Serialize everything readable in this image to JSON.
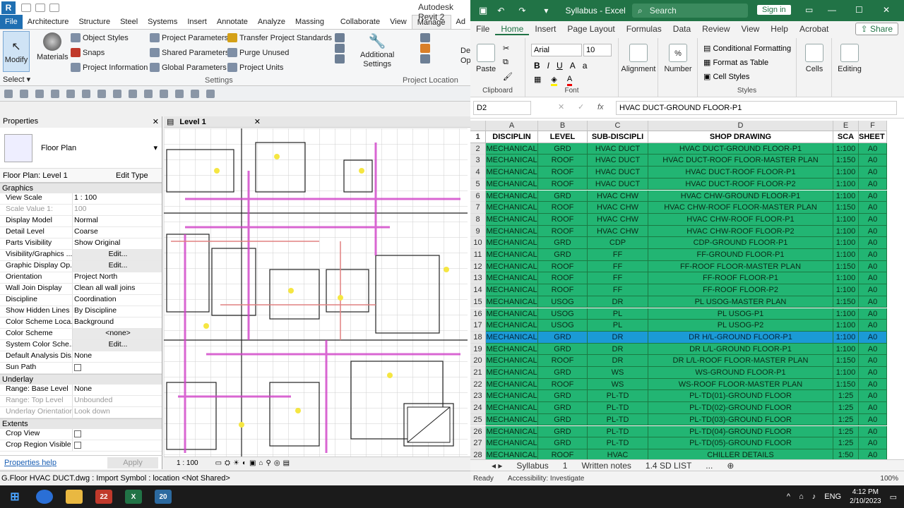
{
  "revit": {
    "title": "Autodesk Revit 2",
    "tabs": [
      "File",
      "Architecture",
      "Structure",
      "Steel",
      "Systems",
      "Insert",
      "Annotate",
      "Analyze",
      "Massing & Site",
      "Collaborate",
      "View",
      "Manage",
      "Ad"
    ],
    "ribbon": {
      "modify": "Modify",
      "select": "Select",
      "materials": "Materials",
      "object_styles": "Object  Styles",
      "snaps": "Snaps",
      "project_information": "Project  Information",
      "project_parameters": "Project  Parameters",
      "shared_parameters": "Shared  Parameters",
      "global_parameters": "Global  Parameters",
      "transfer": "Transfer  Project Standards",
      "purge": "Purge  Unused",
      "units": "Project  Units",
      "settings_label": "Settings",
      "additional": "Additional",
      "additional2": "Settings",
      "project_location": "Project Location",
      "de": "De",
      "op": "Op"
    },
    "properties": {
      "title": "Properties",
      "type": "Floor Plan",
      "selector": "Floor Plan: Level 1",
      "edit_type": "Edit Type",
      "groups": {
        "graphics": "Graphics",
        "underlay": "Underlay",
        "extents": "Extents"
      },
      "graphics_rows": [
        {
          "k": "View Scale",
          "v": "1 : 100"
        },
        {
          "k": "Scale Value    1:",
          "v": "100"
        },
        {
          "k": "Display Model",
          "v": "Normal"
        },
        {
          "k": "Detail Level",
          "v": "Coarse"
        },
        {
          "k": "Parts Visibility",
          "v": "Show Original"
        },
        {
          "k": "Visibility/Graphics ...",
          "v": "Edit..."
        },
        {
          "k": "Graphic Display Op...",
          "v": "Edit..."
        },
        {
          "k": "Orientation",
          "v": "Project North"
        },
        {
          "k": "Wall Join Display",
          "v": "Clean all wall joins"
        },
        {
          "k": "Discipline",
          "v": "Coordination"
        },
        {
          "k": "Show Hidden Lines",
          "v": "By Discipline"
        },
        {
          "k": "Color Scheme Loca...",
          "v": "Background"
        },
        {
          "k": "Color Scheme",
          "v": "<none>"
        },
        {
          "k": "System Color Sche...",
          "v": "Edit..."
        },
        {
          "k": "Default Analysis Dis...",
          "v": "None"
        },
        {
          "k": "Sun Path",
          "v": ""
        }
      ],
      "underlay_rows": [
        {
          "k": "Range: Base Level",
          "v": "None"
        },
        {
          "k": "Range: Top Level",
          "v": "Unbounded"
        },
        {
          "k": "Underlay Orientation",
          "v": "Look down"
        }
      ],
      "extents_rows": [
        {
          "k": "Crop View",
          "v": ""
        },
        {
          "k": "Crop Region Visible",
          "v": ""
        }
      ],
      "help": "Properties help",
      "apply": "Apply"
    },
    "view_tab": "Level 1",
    "view_scale": "1 : 100",
    "status": "G.Floor  HVAC DUCT.dwg : Import Symbol : location <Not Shared>"
  },
  "excel": {
    "title": "Syllabus  -  Excel",
    "search": "Search",
    "signin": "Sign in",
    "tabs": [
      "File",
      "Home",
      "Insert",
      "Page Layout",
      "Formulas",
      "Data",
      "Review",
      "View",
      "Help",
      "Acrobat"
    ],
    "share": "Share",
    "ribbon": {
      "paste": "Paste",
      "clipboard": "Clipboard",
      "font_name": "Arial",
      "font_size": "10",
      "font": "Font",
      "alignment": "Alignment",
      "number": "Number",
      "cond": "Conditional Formatting",
      "table": "Format as Table",
      "cellstyles": "Cell Styles",
      "styles": "Styles",
      "cells": "Cells",
      "editing": "Editing"
    },
    "namebox": "D2",
    "formula": "HVAC DUCT-GROUND FLOOR-P1",
    "columns": [
      "A",
      "B",
      "C",
      "D",
      "E",
      "F"
    ],
    "headers": [
      "DISCIPLIN",
      "LEVEL",
      "SUB-DISCIPLI",
      "SHOP DRAWING",
      "SCA",
      "SHEET S"
    ],
    "rows": [
      [
        "2",
        "MECHANICAL",
        "GRD",
        "HVAC DUCT",
        "HVAC DUCT-GROUND FLOOR-P1",
        "1:100",
        "A0"
      ],
      [
        "3",
        "MECHANICAL",
        "ROOF",
        "HVAC DUCT",
        "HVAC DUCT-ROOF FLOOR-MASTER PLAN",
        "1:150",
        "A0"
      ],
      [
        "4",
        "MECHANICAL",
        "ROOF",
        "HVAC DUCT",
        "HVAC DUCT-ROOF FLOOR-P1",
        "1:100",
        "A0"
      ],
      [
        "5",
        "MECHANICAL",
        "ROOF",
        "HVAC DUCT",
        "HVAC DUCT-ROOF FLOOR-P2",
        "1:100",
        "A0"
      ],
      [
        "6",
        "MECHANICAL",
        "GRD",
        "HVAC CHW",
        "HVAC CHW-GROUND FLOOR-P1",
        "1:100",
        "A0"
      ],
      [
        "7",
        "MECHANICAL",
        "ROOF",
        "HVAC CHW",
        "HVAC CHW-ROOF FLOOR-MASTER PLAN",
        "1:150",
        "A0"
      ],
      [
        "8",
        "MECHANICAL",
        "ROOF",
        "HVAC CHW",
        "HVAC CHW-ROOF FLOOR-P1",
        "1:100",
        "A0"
      ],
      [
        "9",
        "MECHANICAL",
        "ROOF",
        "HVAC CHW",
        "HVAC CHW-ROOF FLOOR-P2",
        "1:100",
        "A0"
      ],
      [
        "10",
        "MECHANICAL",
        "GRD",
        "CDP",
        "CDP-GROUND FLOOR-P1",
        "1:100",
        "A0"
      ],
      [
        "11",
        "MECHANICAL",
        "GRD",
        "FF",
        "FF-GROUND FLOOR-P1",
        "1:100",
        "A0"
      ],
      [
        "12",
        "MECHANICAL",
        "ROOF",
        "FF",
        "FF-ROOF FLOOR-MASTER PLAN",
        "1:150",
        "A0"
      ],
      [
        "13",
        "MECHANICAL",
        "ROOF",
        "FF",
        "FF-ROOF FLOOR-P1",
        "1:100",
        "A0"
      ],
      [
        "14",
        "MECHANICAL",
        "ROOF",
        "FF",
        "FF-ROOF FLOOR-P2",
        "1:100",
        "A0"
      ],
      [
        "15",
        "MECHANICAL",
        "USOG",
        "DR",
        "PL USOG-MASTER PLAN",
        "1:150",
        "A0"
      ],
      [
        "16",
        "MECHANICAL",
        "USOG",
        "PL",
        "PL USOG-P1",
        "1:100",
        "A0"
      ],
      [
        "17",
        "MECHANICAL",
        "USOG",
        "PL",
        "PL USOG-P2",
        "1:100",
        "A0"
      ],
      [
        "18",
        "MECHANICAL",
        "GRD",
        "DR",
        "DR H/L-GROUND FLOOR-P1",
        "1:100",
        "A0"
      ],
      [
        "19",
        "MECHANICAL",
        "GRD",
        "DR",
        "DR L/L-GROUND FLOOR-P1",
        "1:100",
        "A0"
      ],
      [
        "20",
        "MECHANICAL",
        "ROOF",
        "DR",
        "DR L/L-ROOF FLOOR-MASTER PLAN",
        "1:150",
        "A0"
      ],
      [
        "21",
        "MECHANICAL",
        "GRD",
        "WS",
        "WS-GROUND FLOOR-P1",
        "1:100",
        "A0"
      ],
      [
        "22",
        "MECHANICAL",
        "ROOF",
        "WS",
        "WS-ROOF FLOOR-MASTER PLAN",
        "1:150",
        "A0"
      ],
      [
        "23",
        "MECHANICAL",
        "GRD",
        "PL-TD",
        "PL-TD(01)-GROUND FLOOR",
        "1:25",
        "A0"
      ],
      [
        "24",
        "MECHANICAL",
        "GRD",
        "PL-TD",
        "PL-TD(02)-GROUND FLOOR",
        "1:25",
        "A0"
      ],
      [
        "25",
        "MECHANICAL",
        "GRD",
        "PL-TD",
        "PL-TD(03)-GROUND FLOOR",
        "1:25",
        "A0"
      ],
      [
        "26",
        "MECHANICAL",
        "GRD",
        "PL-TD",
        "PL-TD(04)-GROUND FLOOR",
        "1:25",
        "A0"
      ],
      [
        "27",
        "MECHANICAL",
        "GRD",
        "PL-TD",
        "PL-TD(05)-GROUND FLOOR",
        "1:25",
        "A0"
      ],
      [
        "28",
        "MECHANICAL",
        "ROOF",
        "HVAC",
        "CHILLER DETAILS",
        "1:50",
        "A0"
      ]
    ],
    "sheets": [
      "Syllabus",
      "1",
      "Written notes",
      "1.4 SD LIST",
      "..."
    ],
    "status_ready": "Ready",
    "status_access": "Accessibility: Investigate",
    "zoom": "100%"
  },
  "taskbar": {
    "revit_badge": "22",
    "revit2_badge": "20",
    "lang": "ENG",
    "time": "4:12 PM",
    "date": "2/10/2023"
  },
  "colors": {
    "excel_green": "#217346",
    "row_green": "#22b573",
    "row_selected": "#1b9ad6",
    "revit_blue": "#1f6fb2"
  }
}
